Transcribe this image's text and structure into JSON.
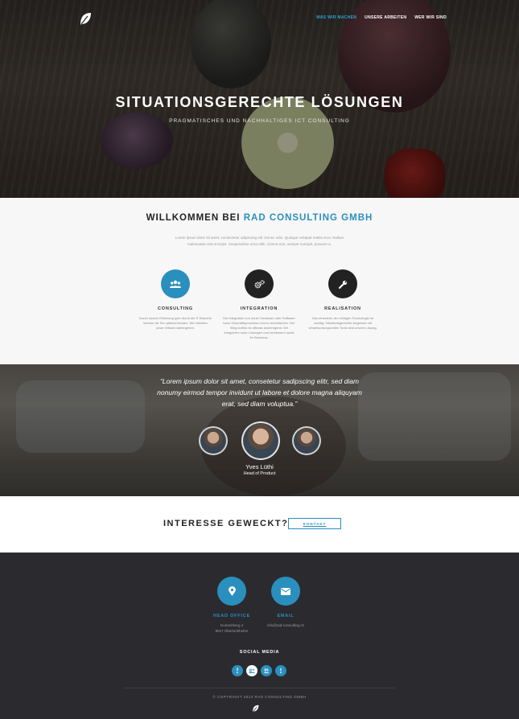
{
  "colors": {
    "accent": "#2a8fbd",
    "dark": "#222222",
    "footer": "#2b2b2f"
  },
  "header": {
    "logo_icon": "leaf-logo-icon",
    "nav": [
      {
        "label": "WAS WIR MACHEN",
        "active": true
      },
      {
        "label": "UNSERE ARBEITEN",
        "active": false
      },
      {
        "label": "WER WIR SIND",
        "active": false
      }
    ]
  },
  "hero": {
    "title": "SITUATIONSGERECHTE LÖSUNGEN",
    "subtitle": "PRAGMATISCHES UND NACHHALTIGES ICT CONSULTING"
  },
  "welcome": {
    "title_prefix": "WILLKOMMEN BEI ",
    "title_accent": "RAD CONSULTING GMBH",
    "text": "Lorem ipsum dolor sit amet, consectetur adipiscing elit. Donec odio. Quisque volutpat mattis eros. Nullam malesuada erat ut turpis. Suspendisse urna nibh, viverra non, semper suscipit, posuere a.",
    "services": [
      {
        "icon": "users-icon",
        "label": "CONSULTING",
        "desc": "Durch unsere Erfahrung quer durch die IT Branche können wir Sie optimal beraten. Wir möchten unser Wissen weitergeben."
      },
      {
        "icon": "gears-icon",
        "label": "INTEGRATION",
        "desc": "Die Integration von neuer Hardware oder Software kann Geschäftsprozesse enorm vereinfachen. Der Weg dorthin ist oftmals anstrengend. Wir integrieren neue Lösungen und verbessern somit Ihr Business."
      },
      {
        "icon": "wrench-icon",
        "label": "REALISATION",
        "desc": "Das einsetzen der richtigen Technologie ist wichtig. Situationsgerechte Angebote mit verantwortungsvollen Tools sind unsere Lösung."
      }
    ]
  },
  "testimonial": {
    "quote": "“Lorem ipsum dolor sit amet, consetetur sadipscing elitr, sed diam nonumy eirmod tempor invidunt ut labore et dolore magna aliquyam erat, sed diam voluptua.”",
    "name": "Yves Lüthi",
    "role": "Head of Product"
  },
  "cta": {
    "title": "INTERESSE GEWECKT?",
    "button": "KONTAKT"
  },
  "footer": {
    "office": {
      "icon": "map-marker-icon",
      "label": "HEAD OFFICE",
      "line1": "Gunzenberg 4",
      "line2": "8917 Oberlunkhofen"
    },
    "email": {
      "icon": "envelope-icon",
      "label": "EMAIL",
      "value": "info@rad-consulting.ch"
    },
    "social_title": "SOCIAL MEDIA",
    "social": [
      {
        "icon": "facebook-icon",
        "glyph": "f"
      },
      {
        "icon": "google-plus-icon",
        "glyph": "g+"
      },
      {
        "icon": "linkedin-icon",
        "glyph": "in"
      },
      {
        "icon": "twitter-icon",
        "glyph": "t"
      }
    ],
    "copyright": "© COPYRIGHT 2013 RAD CONSULTING GMBH"
  }
}
